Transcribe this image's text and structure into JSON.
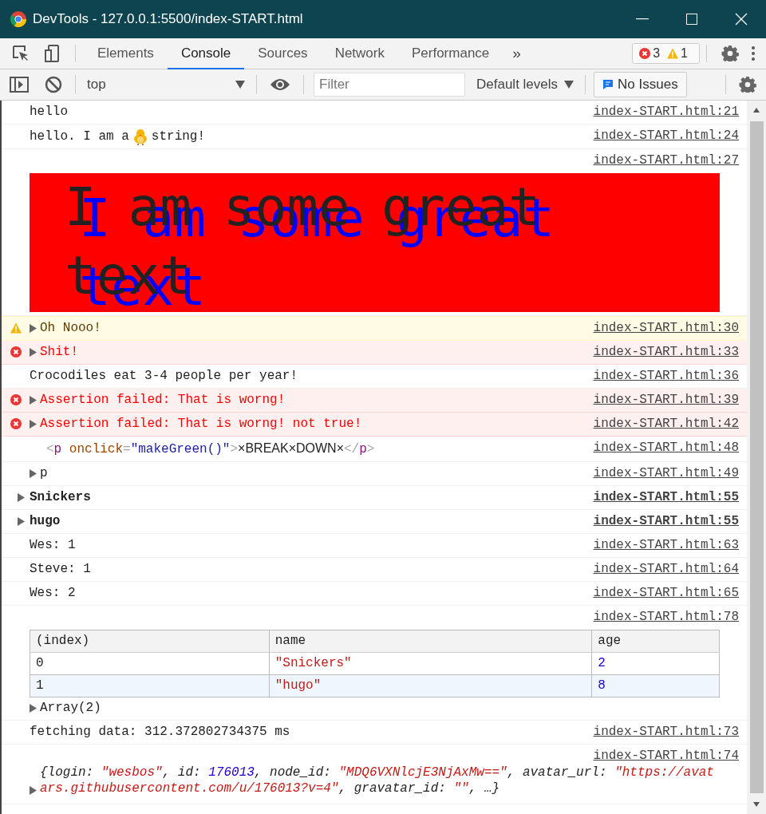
{
  "window": {
    "title": "DevTools - 127.0.0.1:5500/index-START.html"
  },
  "tabs": [
    {
      "label": "Elements",
      "selected": false
    },
    {
      "label": "Console",
      "selected": true
    },
    {
      "label": "Sources",
      "selected": false
    },
    {
      "label": "Network",
      "selected": false
    },
    {
      "label": "Performance",
      "selected": false
    }
  ],
  "more_tabs": "»",
  "counts": {
    "errors": "3",
    "warnings": "1"
  },
  "toolbar": {
    "context": "top",
    "filter_placeholder": "Filter",
    "levels": "Default levels",
    "issues": "No Issues"
  },
  "messages": [
    {
      "kind": "log",
      "text": "hello",
      "source": "index-START.html:21"
    },
    {
      "kind": "emoji",
      "before": "hello. I am a",
      "after": "string!",
      "source": "index-START.html:24"
    },
    {
      "kind": "styled",
      "text": "I am some great text",
      "source": "index-START.html:27"
    },
    {
      "kind": "warn",
      "text": "Oh Nooo!",
      "source": "index-START.html:30"
    },
    {
      "kind": "error",
      "text": "Shit!",
      "source": "index-START.html:33"
    },
    {
      "kind": "log",
      "text": "Crocodiles eat 3-4 people per year!",
      "source": "index-START.html:36"
    },
    {
      "kind": "error",
      "text": "Assertion failed: That is worng!",
      "source": "index-START.html:39"
    },
    {
      "kind": "error",
      "text": "Assertion failed: That is worng! not true!",
      "source": "index-START.html:42"
    },
    {
      "kind": "html",
      "parts": [
        {
          "kind": "bracket",
          "text": "<"
        },
        {
          "kind": "tag",
          "text": "p"
        },
        {
          "kind": "attr",
          "text": " onclick"
        },
        {
          "kind": "bracket",
          "text": "="
        },
        {
          "kind": "value",
          "text": "\"makeGreen()\""
        },
        {
          "kind": "bracket",
          "text": ">"
        },
        {
          "kind": "text",
          "text": "×BREAK×DOWN×"
        },
        {
          "kind": "bracket",
          "text": "</"
        },
        {
          "kind": "tag",
          "text": "p"
        },
        {
          "kind": "bracket",
          "text": ">"
        }
      ],
      "source": "index-START.html:48"
    },
    {
      "kind": "element",
      "text": "p",
      "source": "index-START.html:49"
    },
    {
      "kind": "group",
      "text": "Snickers",
      "source": "index-START.html:55"
    },
    {
      "kind": "group",
      "text": "hugo",
      "source": "index-START.html:55"
    },
    {
      "kind": "log",
      "text": "Wes: 1",
      "source": "index-START.html:63"
    },
    {
      "kind": "log",
      "text": "Steve: 1",
      "source": "index-START.html:64"
    },
    {
      "kind": "log",
      "text": "Wes: 2",
      "source": "index-START.html:65"
    },
    {
      "kind": "table",
      "source": "index-START.html:78",
      "columns": [
        "(index)",
        "name",
        "age"
      ],
      "rows": [
        [
          {
            "kind": "index",
            "text": "0"
          },
          {
            "kind": "string",
            "text": "\"Snickers\""
          },
          {
            "kind": "number",
            "text": "2"
          }
        ],
        [
          {
            "kind": "index",
            "text": "1"
          },
          {
            "kind": "string",
            "text": "\"hugo\""
          },
          {
            "kind": "number",
            "text": "8"
          }
        ]
      ],
      "summary": "Array(2)"
    },
    {
      "kind": "log",
      "text": "fetching data: 312.372802734375 ms",
      "source": "index-START.html:73"
    },
    {
      "kind": "object",
      "source": "index-START.html:74",
      "parts": [
        {
          "kind": "plain",
          "text": "{login: "
        },
        {
          "kind": "string",
          "text": "\"wesbos\""
        },
        {
          "kind": "plain",
          "text": ", id: "
        },
        {
          "kind": "number",
          "text": "176013"
        },
        {
          "kind": "plain",
          "text": ", node_id: "
        },
        {
          "kind": "string",
          "text": "\"MDQ6VXNlcjE3NjAxMw==\""
        },
        {
          "kind": "plain",
          "text": ", avatar_url: "
        },
        {
          "kind": "string",
          "text": "\"https://avatars.githubusercontent.com/u/176013?v=4\""
        },
        {
          "kind": "plain",
          "text": ", gravatar_id: "
        },
        {
          "kind": "string",
          "text": "\"\""
        },
        {
          "kind": "plain",
          "text": ", …}"
        }
      ]
    }
  ]
}
